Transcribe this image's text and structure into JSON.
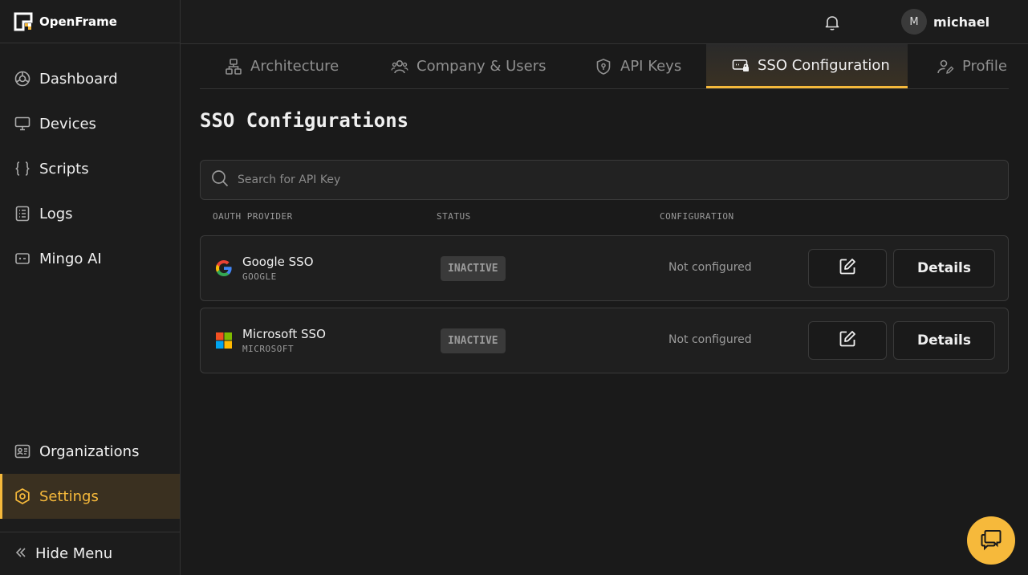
{
  "app": {
    "name": "OpenFrame"
  },
  "sidebar": {
    "items": [
      {
        "label": "Dashboard",
        "icon": "dashboard-icon"
      },
      {
        "label": "Devices",
        "icon": "monitor-icon"
      },
      {
        "label": "Scripts",
        "icon": "braces-icon"
      },
      {
        "label": "Logs",
        "icon": "log-list-icon"
      },
      {
        "label": "Mingo AI",
        "icon": "ai-chat-icon"
      }
    ],
    "bottom_items": [
      {
        "label": "Organizations",
        "icon": "id-card-icon"
      },
      {
        "label": "Settings",
        "icon": "settings-icon",
        "active": true
      }
    ],
    "hide_menu_label": "Hide Menu"
  },
  "header": {
    "user": {
      "initial": "M",
      "name": "michael"
    }
  },
  "tabs": [
    {
      "label": "Architecture",
      "icon": "architecture-icon"
    },
    {
      "label": "Company & Users",
      "icon": "users-icon"
    },
    {
      "label": "API Keys",
      "icon": "shield-key-icon"
    },
    {
      "label": "SSO Configuration",
      "icon": "sso-lock-icon",
      "active": true
    },
    {
      "label": "Profile",
      "icon": "profile-edit-icon"
    }
  ],
  "page": {
    "title": "SSO Configurations",
    "search_placeholder": "Search for API Key"
  },
  "table": {
    "columns": [
      "OAUTH PROVIDER",
      "STATUS",
      "CONFIGURATION"
    ],
    "rows": [
      {
        "name": "Google SSO",
        "code": "GOOGLE",
        "status": "INACTIVE",
        "configuration": "Not configured",
        "action": "Details",
        "icon": "google-icon"
      },
      {
        "name": "Microsoft SSO",
        "code": "MICROSOFT",
        "status": "INACTIVE",
        "configuration": "Not configured",
        "action": "Details",
        "icon": "microsoft-icon"
      }
    ]
  },
  "colors": {
    "accent": "#f6b93b",
    "background": "#1a1a1a"
  }
}
